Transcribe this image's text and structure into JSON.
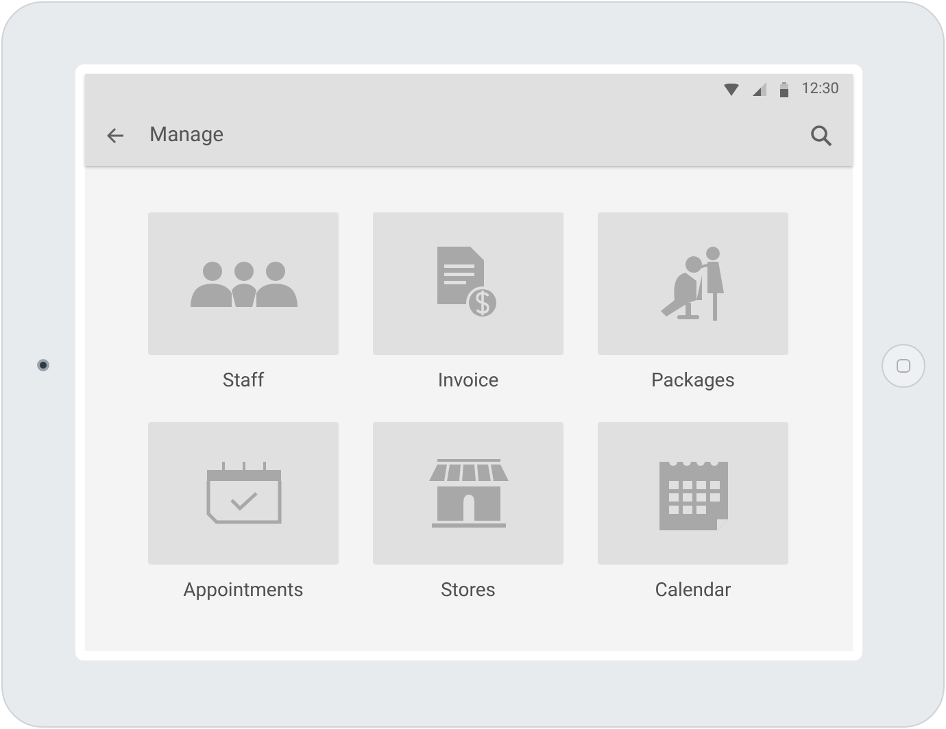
{
  "status_bar": {
    "time": "12:30"
  },
  "app_bar": {
    "title": "Manage"
  },
  "tiles": [
    {
      "label": "Staff"
    },
    {
      "label": "Invoice"
    },
    {
      "label": "Packages"
    },
    {
      "label": "Appointments"
    },
    {
      "label": "Stores"
    },
    {
      "label": "Calendar"
    }
  ]
}
